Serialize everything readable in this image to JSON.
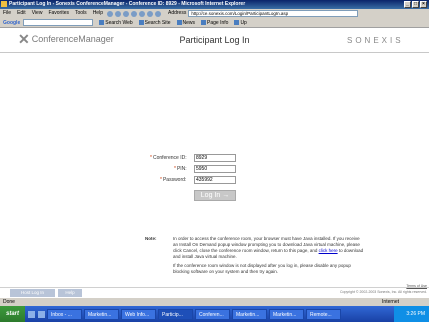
{
  "browser": {
    "title": "Participant Log In - Sonexis ConferenceManager - Conference ID: 8929 - Microsoft Internet Explorer",
    "menus": [
      "File",
      "Edit",
      "View",
      "Favorites",
      "Tools",
      "Help"
    ],
    "address_label": "Address",
    "address_url": "http://ce.sonexis.com/Login/ParticipantLogIn.asp",
    "google_label": "Google",
    "search_web": "Search Web",
    "search_site": "Search Site",
    "news": "News",
    "page_info": "Page Info",
    "up": "Up",
    "status_left": "Done",
    "status_zone": "Internet"
  },
  "header": {
    "logo": "ConferenceManager",
    "page_title": "Participant Log In",
    "brand": "SONEXIS"
  },
  "form": {
    "conference_id_label": "Conference ID:",
    "conference_id_value": "8929",
    "pin_label": "PIN:",
    "pin_value": "5950",
    "password_label": "Password:",
    "password_value": "435992",
    "login_button": "Log In"
  },
  "note": {
    "label": "Note:",
    "para1_a": "In order to access the conference room, your browser must have Java installed. If you receive an Install On Demand popup window prompting you to download Java virtual machine, please click Cancel, close the conference room window, return to this page, and",
    "para1_link": "click here",
    "para1_b": "to download and install Java virtual machine.",
    "para2": "If the conference room window is not displayed after you log in, please disable any popup blocking software on your system and then try again."
  },
  "footer": {
    "btn1": "Host Log In",
    "btn2": "Help",
    "terms": "Terms of Use",
    "copyright": "Copyright © 2002-2003 Sonexis, Inc. All rights reserved."
  },
  "taskbar": {
    "start": "start",
    "tasks": [
      "Inbox - ...",
      "Marketin...",
      "Web Info...",
      "Particip...",
      "Conferen...",
      "Marketin...",
      "Marketin...",
      "Remote..."
    ],
    "clock": "3:26 PM"
  }
}
